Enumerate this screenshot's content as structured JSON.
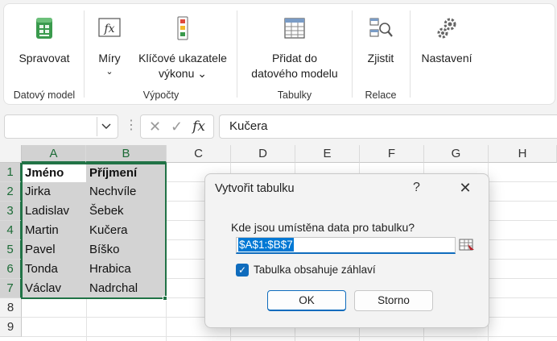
{
  "ribbon": {
    "groups": [
      {
        "label": "Datový model",
        "buttons": [
          {
            "label": "Spravovat"
          }
        ]
      },
      {
        "label": "Výpočty",
        "buttons": [
          {
            "label": "Míry",
            "chevron": "⌄"
          },
          {
            "label1": "Klíčové ukazatele",
            "label2": "výkonu ⌄"
          }
        ]
      },
      {
        "label": "Tabulky",
        "buttons": [
          {
            "label1": "Přidat do",
            "label2": "datového modelu"
          }
        ]
      },
      {
        "label": "Relace",
        "buttons": [
          {
            "label": "Zjistit"
          }
        ]
      },
      {
        "label": "",
        "buttons": [
          {
            "label": "Nastavení"
          }
        ]
      }
    ]
  },
  "formula_bar": {
    "name_box": "",
    "fx": "fx",
    "cancel_glyph": "✕",
    "enter_glyph": "✓",
    "formula": "Kučera"
  },
  "sheet": {
    "columns": [
      "A",
      "B",
      "C",
      "D",
      "E",
      "F",
      "G",
      "H"
    ],
    "rows": [
      "1",
      "2",
      "3",
      "4",
      "5",
      "6",
      "7",
      "8",
      "9"
    ],
    "cells": [
      [
        "Jméno",
        "Příjmení"
      ],
      [
        "Jirka",
        "Nechvíle"
      ],
      [
        "Ladislav",
        "Šebek"
      ],
      [
        "Martin",
        "Kučera"
      ],
      [
        "Pavel",
        "Bíško"
      ],
      [
        "Tonda",
        "Hrabica"
      ],
      [
        "Václav",
        "Nadrchal"
      ]
    ]
  },
  "dialog": {
    "title": "Vytvořit tabulku",
    "help": "?",
    "close": "✕",
    "question": "Kde jsou umístěna data pro tabulku?",
    "range": "$A$1:$B$7",
    "has_headers_label": "Tabulka obsahuje záhlaví",
    "has_headers_checked": true,
    "ok_label": "OK",
    "cancel_label": "Storno"
  },
  "colors": {
    "accent": "#0f6cbd",
    "selection_green": "#217346"
  }
}
